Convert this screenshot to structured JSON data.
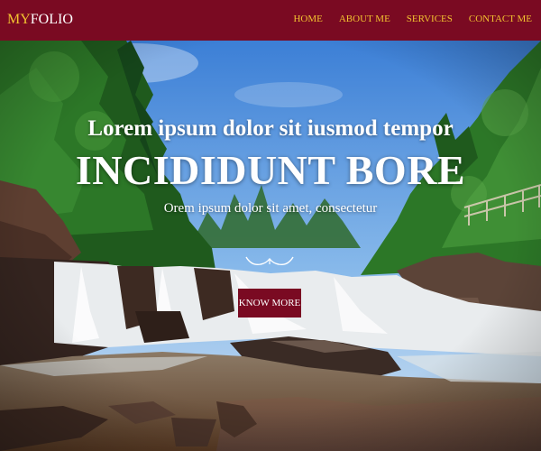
{
  "brand": {
    "accent": "MY",
    "rest": "FOLIO"
  },
  "nav": {
    "items": [
      {
        "label": "HOME"
      },
      {
        "label": "ABOUT ME"
      },
      {
        "label": "SERVICES"
      },
      {
        "label": "CONTACT ME"
      }
    ]
  },
  "hero": {
    "subtitle": "Lorem ipsum dolor sit iusmod tempor",
    "title": "INCIDIDUNT BORE",
    "text": "Orem ipsum dolor sit amet, consectetur",
    "button_label": "KNOW MORE"
  },
  "colors": {
    "navbar": "#7a0a22",
    "accent": "#f2c230",
    "button": "#7a0a22",
    "text": "#ffffff"
  }
}
